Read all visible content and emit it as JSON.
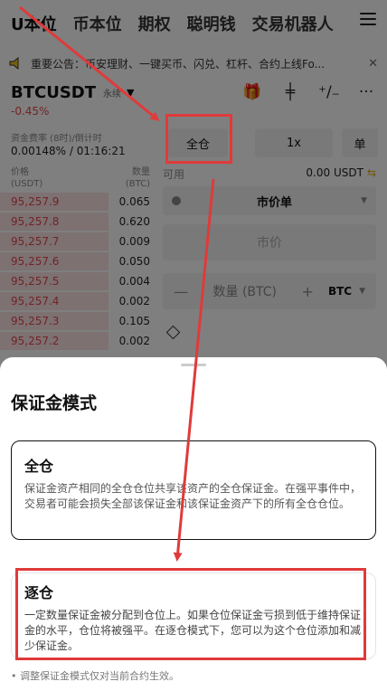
{
  "tabs": [
    "U本位",
    "币本位",
    "期权",
    "聪明钱",
    "交易机器人"
  ],
  "notice": {
    "text": "重要公告：币安理财、一键买币、闪兑、杠杆、合约上线Fo...",
    "close": "✕"
  },
  "pair": {
    "symbol": "BTCUSDT",
    "type": "永续",
    "change": "-0.45%"
  },
  "funding": {
    "label": "资金费率 (8时)/倒计时",
    "value": "0.00148% / 01:16:21"
  },
  "orderbook": {
    "price_header": "价格",
    "price_unit": "(USDT)",
    "qty_header": "数量",
    "qty_unit": "(BTC)",
    "rows": [
      {
        "price": "95,257.9",
        "qty": "0.065"
      },
      {
        "price": "95,257.8",
        "qty": "0.620"
      },
      {
        "price": "95,257.7",
        "qty": "0.009"
      },
      {
        "price": "95,257.6",
        "qty": "0.050"
      },
      {
        "price": "95,257.5",
        "qty": "0.004"
      },
      {
        "price": "95,257.4",
        "qty": "0.002"
      },
      {
        "price": "95,257.3",
        "qty": "0.105"
      },
      {
        "price": "95,257.2",
        "qty": "0.002"
      }
    ]
  },
  "controls": {
    "margin_mode": "全仓",
    "leverage": "1x",
    "position_mode": "单",
    "available_label": "可用",
    "available_value": "0.00 USDT",
    "order_type": "市价单",
    "market_price": "市价",
    "qty_label": "数量 (BTC)",
    "qty_unit": "BTC"
  },
  "sheet": {
    "title": "保证金模式",
    "cross": {
      "title": "全仓",
      "desc": "保证金资产相同的全仓仓位共享该资产的全仓保证金。在强平事件中，交易者可能会损失全部该保证金和该保证金资产下的所有全仓仓位。"
    },
    "isolated": {
      "title": "逐仓",
      "desc": "一定数量保证金被分配到仓位上。如果仓位保证金亏损到低于维持保证金的水平，仓位将被强平。在逐仓模式下，您可以为这个仓位添加和减少保证金。"
    },
    "note": "• 调整保证金模式仅对当前合约生效。"
  },
  "colors": {
    "annotation_red": "#e03a3a",
    "price_red": "#e5484d"
  }
}
